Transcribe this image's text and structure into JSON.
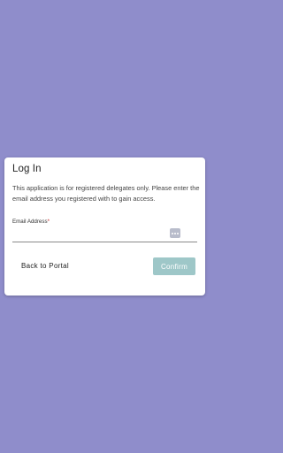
{
  "login": {
    "title": "Log In",
    "description": "This application is for registered delegates only. Please enter the email address you registered with to gain access.",
    "email_label": "Email Address",
    "email_required_mark": "*",
    "email_value": "",
    "password_manager_icon": "password-manager-icon",
    "back_label": "Back to Portal",
    "confirm_label": "Confirm"
  },
  "colors": {
    "background": "#8f8dcb",
    "card": "#ffffff",
    "confirm_disabled": "#9ec7c8",
    "required": "#c62828"
  }
}
